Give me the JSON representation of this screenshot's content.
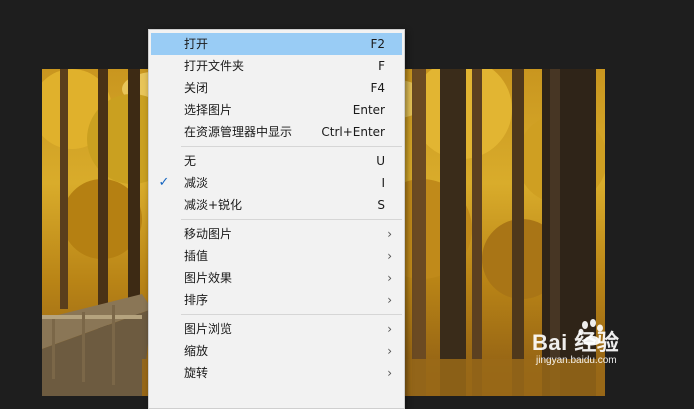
{
  "menu": {
    "groups": [
      [
        {
          "label": "打开",
          "shortcut": "F2",
          "highlighted": true
        },
        {
          "label": "打开文件夹",
          "shortcut": "F"
        },
        {
          "label": "关闭",
          "shortcut": "F4"
        },
        {
          "label": "选择图片",
          "shortcut": "Enter"
        },
        {
          "label": "在资源管理器中显示",
          "shortcut": "Ctrl+Enter"
        }
      ],
      [
        {
          "label": "无",
          "shortcut": "U"
        },
        {
          "label": "减淡",
          "shortcut": "I",
          "checked": true
        },
        {
          "label": "减淡+锐化",
          "shortcut": "S"
        }
      ],
      [
        {
          "label": "移动图片",
          "submenu": true
        },
        {
          "label": "插值",
          "submenu": true
        },
        {
          "label": "图片效果",
          "submenu": true
        },
        {
          "label": "排序",
          "submenu": true
        }
      ],
      [
        {
          "label": "图片浏览",
          "submenu": true
        },
        {
          "label": "缩放",
          "submenu": true
        },
        {
          "label": "旋转",
          "submenu": true
        }
      ]
    ],
    "check_glyph": "✓",
    "arrow_glyph": "›"
  },
  "watermark": {
    "brand": "Bai 经验",
    "url": "jingyan.baidu.com",
    "icon": "baidu-paw-icon"
  },
  "colors": {
    "highlight": "#99ccf5",
    "menu_bg": "#f2f2f2",
    "page_bg": "#1e1e1e"
  }
}
